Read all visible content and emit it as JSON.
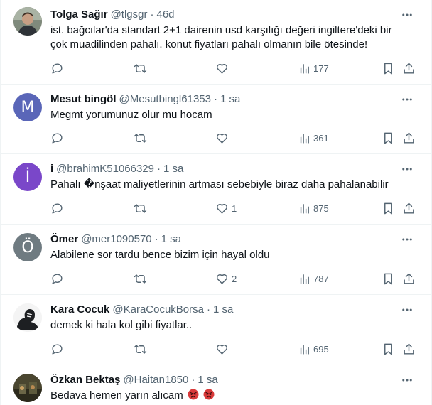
{
  "colors": {
    "text": "#0f1419",
    "secondary": "#536471",
    "divider": "#eff3f4",
    "avatar_mesut": "#5a66b8",
    "avatar_i": "#7a47c9",
    "avatar_omer": "#6f7b81"
  },
  "icons": {
    "reply": "speech-bubble",
    "retweet": "retweet-arrows",
    "like": "heart",
    "views": "bar-chart",
    "bookmark": "bookmark",
    "share": "share-upload",
    "more": "three-dots"
  },
  "tweets": [
    {
      "name": "Tolga Sağır",
      "handle": "@tlgsgr",
      "sep": "·",
      "time": "46d",
      "text": "ist. bağcılar'da standart 2+1 dairenin usd karşılığı değeri ingiltere'deki bir çok muadilinden pahalı. konut fiyatları pahalı olmanın bile ötesinde!",
      "likes": "",
      "views": "177"
    },
    {
      "name": "Mesut bingöl",
      "handle": "@Mesutbingl61353",
      "avatar_letter": "M",
      "sep": "·",
      "time": "1 sa",
      "text": "Megmt yorumunuz olur mu hocam",
      "likes": "",
      "views": "361"
    },
    {
      "name": "i",
      "handle": "@brahimK51066329",
      "avatar_letter": "İ",
      "sep": "·",
      "time": "1 sa",
      "text": "Pahalı �nşaat maliyetlerinin artması sebebiyle biraz daha pahalanabilir",
      "likes": "1",
      "views": "875"
    },
    {
      "name": "Ömer",
      "handle": "@mer1090570",
      "avatar_letter": "Ö",
      "sep": "·",
      "time": "1 sa",
      "text": "Alabilene sor tardu bence bizim için hayal oldu",
      "likes": "2",
      "views": "787"
    },
    {
      "name": "Kara Cocuk",
      "handle": "@KaraCocukBorsa",
      "sep": "·",
      "time": "1 sa",
      "text": "demek ki hala kol gibi fiyatlar..",
      "likes": "",
      "views": "695"
    },
    {
      "name": "Özkan Bektaş",
      "handle": "@Haitan1850",
      "sep": "·",
      "time": "1 sa",
      "text": "Bedava hemen yarın alıcam",
      "emojis": [
        "angry-face",
        "angry-face"
      ]
    }
  ]
}
